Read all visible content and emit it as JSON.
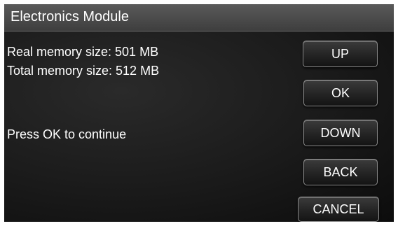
{
  "window": {
    "title": "Electronics Module"
  },
  "info": {
    "real_memory": "Real memory size: 501 MB",
    "total_memory": "Total memory size: 512 MB",
    "prompt": "Press OK to continue"
  },
  "buttons": {
    "up": "UP",
    "ok": "OK",
    "down": "DOWN",
    "back": "BACK",
    "cancel": "CANCEL"
  },
  "colors": {
    "background": "#1a1a1a",
    "titlebar": "#4a4a4a",
    "text": "#ffffff",
    "button_border": "#8a8a8a"
  }
}
